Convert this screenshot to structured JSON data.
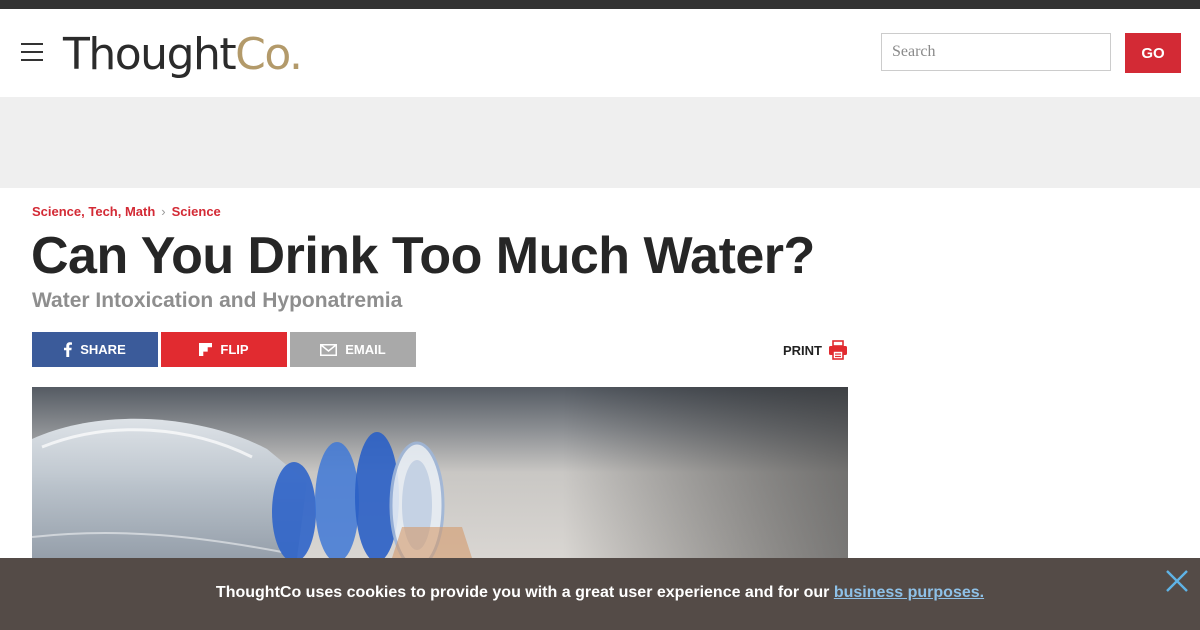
{
  "header": {
    "logo_part1": "Thought",
    "logo_part2": "Co.",
    "search_placeholder": "Search",
    "go_label": "GO"
  },
  "breadcrumb": {
    "items": [
      "Science, Tech, Math",
      "Science"
    ],
    "separator": "›"
  },
  "article": {
    "title": "Can You Drink Too Much Water?",
    "subtitle": "Water Intoxication and Hyponatremia"
  },
  "share": {
    "share_label": "SHARE",
    "flip_label": "FLIP",
    "email_label": "EMAIL",
    "print_label": "PRINT"
  },
  "cookie": {
    "text": "ThoughtCo uses cookies to provide you with a great user experience and for our ",
    "link_text": "business purposes."
  },
  "colors": {
    "accent_red": "#d32a35",
    "facebook_blue": "#3b5b9a",
    "flip_red": "#e12b30",
    "email_gray": "#a9a9a9",
    "cookie_bg": "#544b47",
    "logo_gold": "#b39a6a"
  },
  "icons": [
    "menu-icon",
    "facebook-icon",
    "flipboard-icon",
    "email-icon",
    "printer-icon",
    "close-icon"
  ]
}
